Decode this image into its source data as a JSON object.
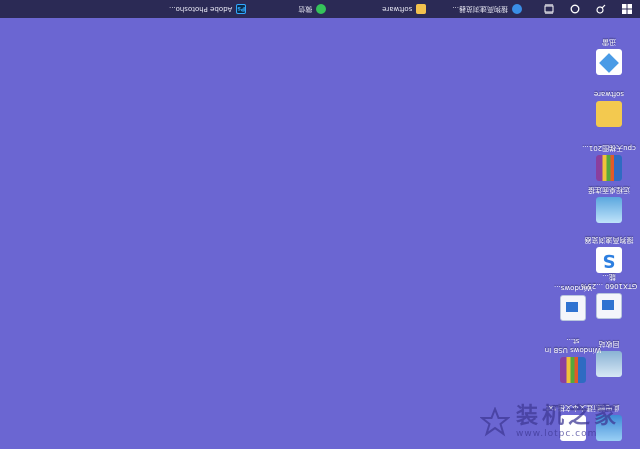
{
  "taskbar": {
    "apps": [
      {
        "label": "搜狗高速浏览器...",
        "icon": "sogou-browser-icon"
      },
      {
        "label": "software",
        "icon": "folder-icon"
      },
      {
        "label": "微信",
        "icon": "wechat-icon"
      },
      {
        "label": "Adobe Photosho...",
        "icon": "photoshop-icon"
      }
    ]
  },
  "desktop": {
    "icons": [
      {
        "label": "此电脑",
        "icon": "this-pc-icon"
      },
      {
        "label": "新建文本文档.txt",
        "icon": "text-file-icon"
      },
      {
        "label": "回收站",
        "icon": "recycle-bin-icon"
      },
      {
        "label": "Windows USB Inst...",
        "icon": "winrar-archive-icon"
      },
      {
        "label": "GTX1060 ...25% 能...",
        "icon": "document-icon"
      },
      {
        "label": "Windows...",
        "icon": "document-icon"
      },
      {
        "label": "搜狗高速浏览器",
        "icon": "sogou-browser-icon"
      },
      {
        "label": "远程桌面连接",
        "icon": "remote-desktop-icon"
      },
      {
        "label": "cpu天梯图201...",
        "icon": "winrar-archive-icon"
      },
      {
        "label": "software",
        "icon": "folder-icon"
      },
      {
        "label": "迅雷",
        "icon": "thunder-icon"
      }
    ]
  },
  "watermark": {
    "title": "装机之家",
    "sub": "www.lotpc.com"
  },
  "colors": {
    "desktop_bg": "#6b66d2",
    "taskbar_bg": "#2b2a55"
  }
}
